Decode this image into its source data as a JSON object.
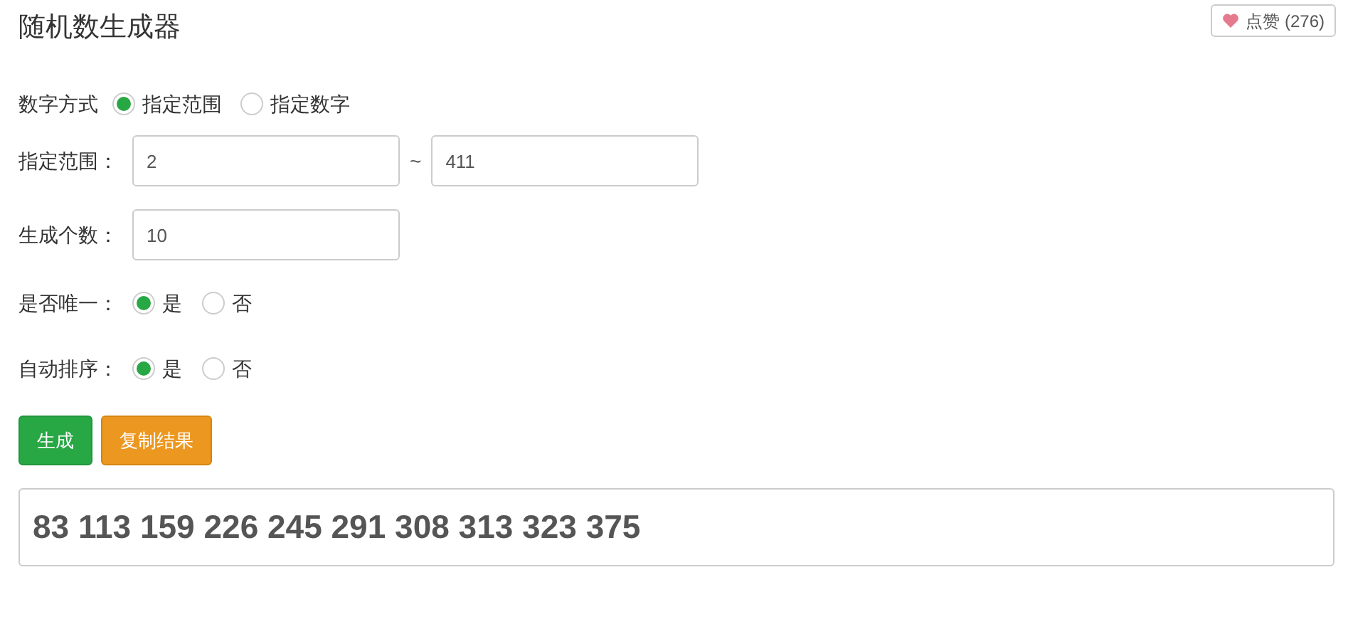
{
  "title": "随机数生成器",
  "like_button": {
    "label": "点赞 (276)"
  },
  "mode": {
    "label": "数字方式",
    "options": [
      {
        "label": "指定范围",
        "selected": true
      },
      {
        "label": "指定数字",
        "selected": false
      }
    ]
  },
  "range": {
    "label": "指定范围：",
    "min": "2",
    "separator": "~",
    "max": "411"
  },
  "count": {
    "label": "生成个数：",
    "value": "10"
  },
  "unique": {
    "label": "是否唯一：",
    "options": [
      {
        "label": "是",
        "selected": true
      },
      {
        "label": "否",
        "selected": false
      }
    ]
  },
  "sort": {
    "label": "自动排序：",
    "options": [
      {
        "label": "是",
        "selected": true
      },
      {
        "label": "否",
        "selected": false
      }
    ]
  },
  "buttons": [
    {
      "label": "生成",
      "kind": "primary"
    },
    {
      "label": "复制结果",
      "kind": "warning"
    }
  ],
  "result": "83 113 159 226 245 291 308 313 323 375"
}
